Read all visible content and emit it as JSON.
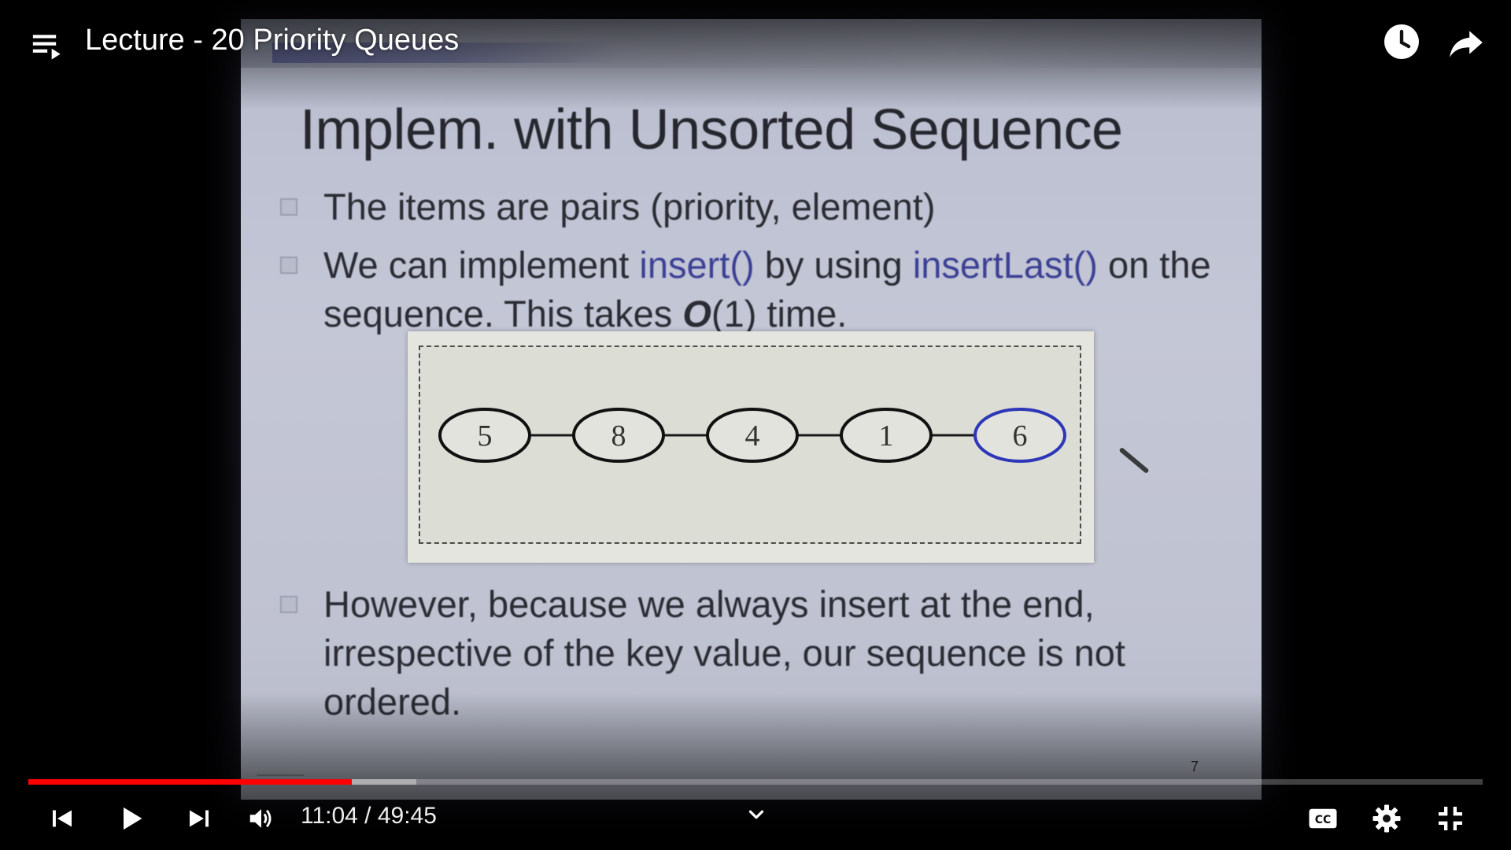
{
  "header": {
    "title": "Lecture - 20 Priority Queues"
  },
  "slide": {
    "title": "Implem. with Unsorted Sequence",
    "bullets": {
      "b1": "The items are pairs (priority, element)",
      "b2_pre": "We can implement ",
      "b2_hl1": "insert()",
      "b2_mid": " by using ",
      "b2_hl2": "insertLast()",
      "b2_post": " on the sequence. This takes ",
      "b2_o": "O",
      "b2_end": "(1) time.",
      "b3": "However, because we always insert at the end, irrespective of the key value, our sequence is not ordered."
    },
    "sequence": [
      "5",
      "8",
      "4",
      "1",
      "6"
    ],
    "highlight_color": "#2d37b8",
    "node_color": "#111111",
    "slide_number": "7"
  },
  "player": {
    "current_time": "11:04",
    "duration": "49:45",
    "time_text": "11:04 / 49:45",
    "played_fraction": 0.2225,
    "buffered_fraction": 0.267,
    "progress_color": "#ff0000"
  },
  "icons": {
    "menu": "playlist-icon",
    "watch_later": "clock-icon",
    "share": "share-arrow-icon",
    "prev": "skip-previous-icon",
    "play": "play-icon",
    "next": "skip-next-icon",
    "volume": "volume-icon",
    "captions": "cc-icon",
    "settings": "gear-icon",
    "exit_fullscreen": "exit-fullscreen-icon",
    "expand": "chevron-down-icon"
  }
}
